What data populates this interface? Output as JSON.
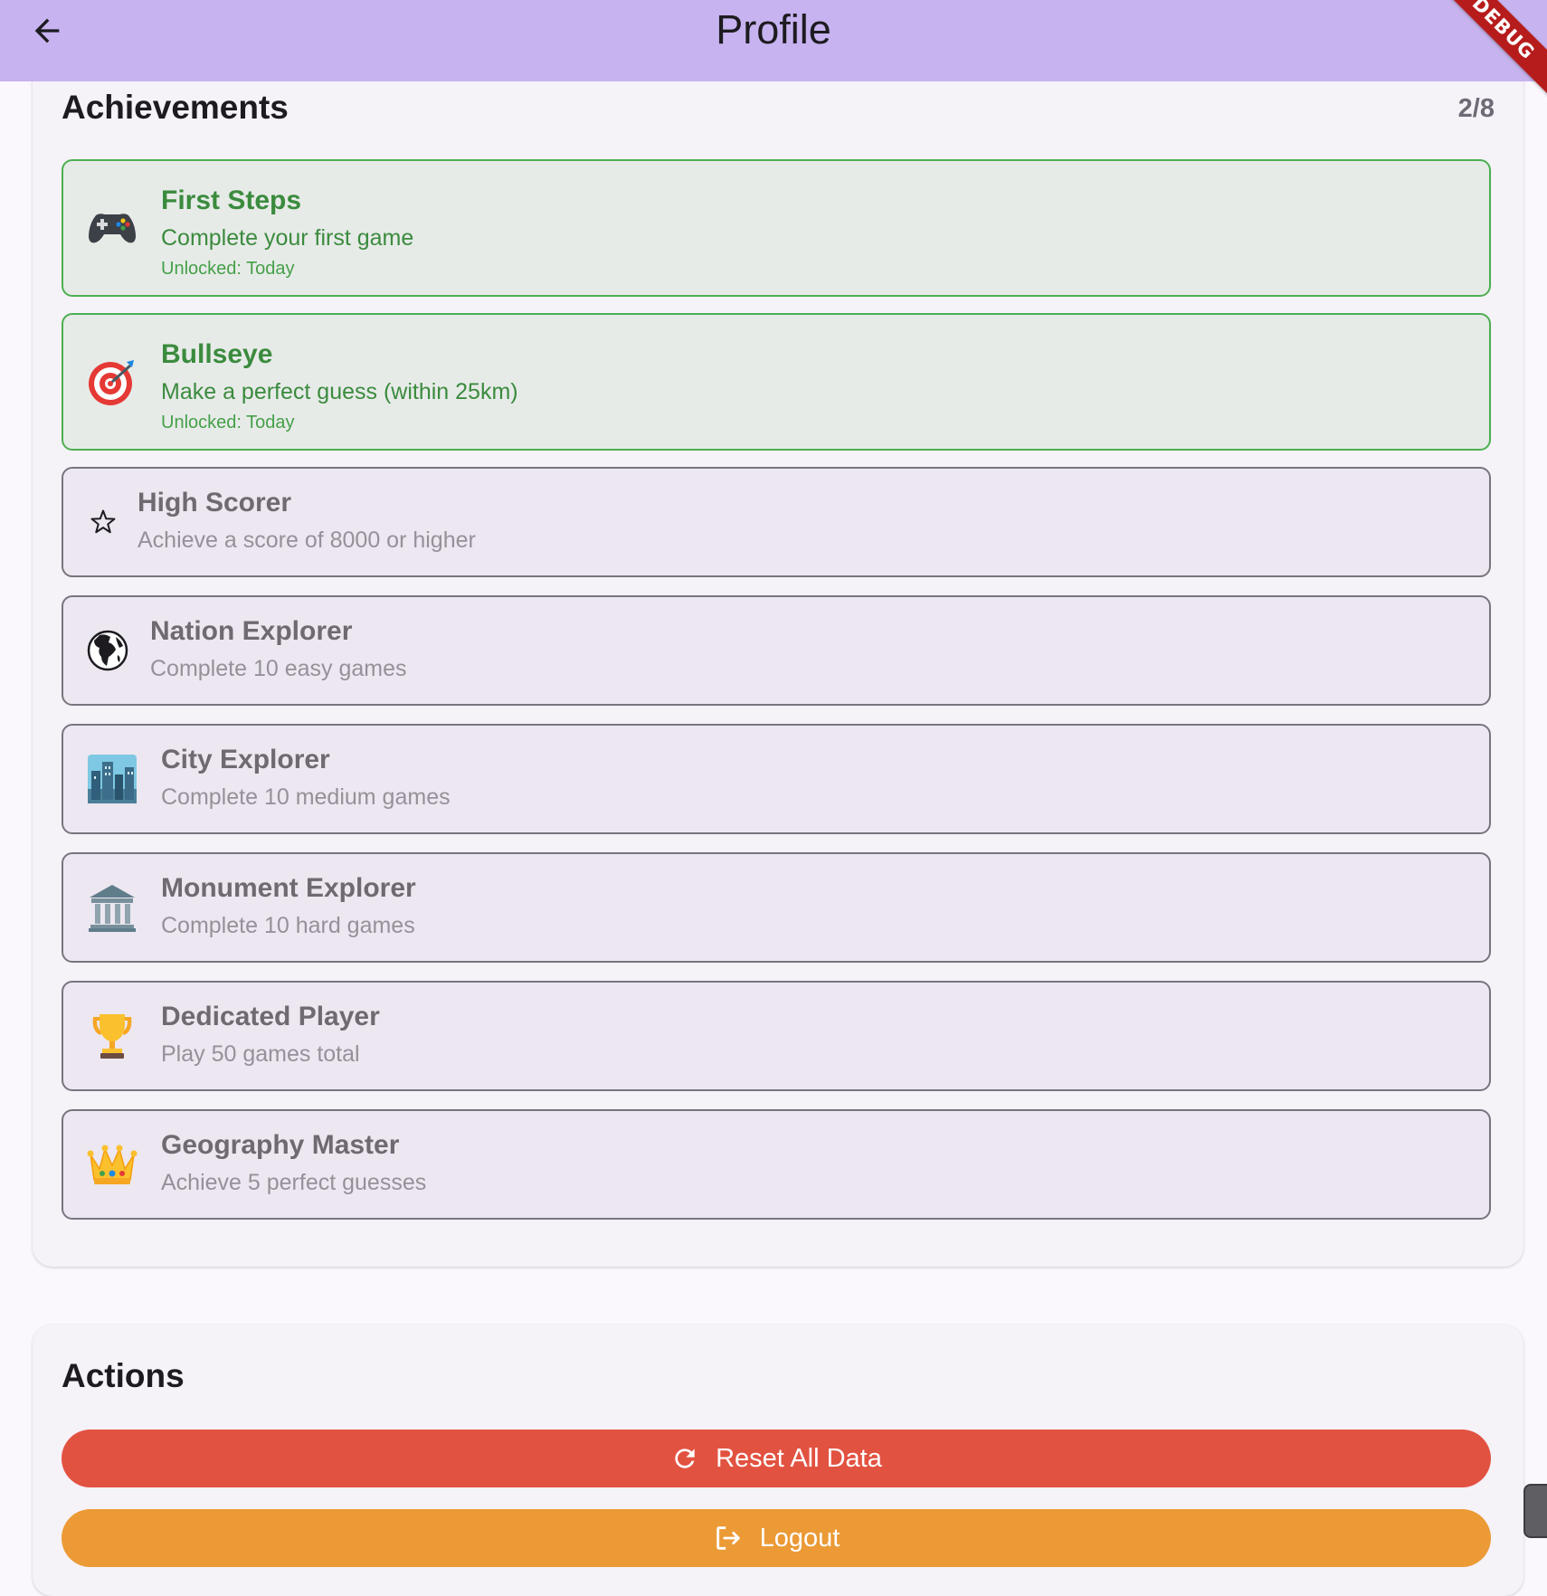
{
  "appbar": {
    "title": "Profile",
    "back_icon": "arrow-back-icon"
  },
  "debug_banner": "DEBUG",
  "achievements": {
    "title": "Achievements",
    "count": "2/8",
    "items": [
      {
        "name": "First Steps",
        "description": "Complete your first game",
        "unlocked": "Unlocked: Today",
        "icon": "game-controller-icon"
      },
      {
        "name": "Bullseye",
        "description": "Make a perfect guess (within 25km)",
        "unlocked": "Unlocked: Today",
        "icon": "target-icon"
      },
      {
        "name": "High Scorer",
        "description": "Achieve a score of 8000 or higher",
        "icon": "star-icon"
      },
      {
        "name": "Nation Explorer",
        "description": "Complete 10 easy games",
        "icon": "globe-icon"
      },
      {
        "name": "City Explorer",
        "description": "Complete 10 medium games",
        "icon": "city-icon"
      },
      {
        "name": "Monument Explorer",
        "description": "Complete 10 hard games",
        "icon": "monument-icon"
      },
      {
        "name": "Dedicated Player",
        "description": "Play 50 games total",
        "icon": "trophy-icon"
      },
      {
        "name": "Geography Master",
        "description": "Achieve 5 perfect guesses",
        "icon": "crown-icon"
      }
    ]
  },
  "actions": {
    "title": "Actions",
    "reset_label": "Reset All Data",
    "logout_label": "Logout"
  },
  "colors": {
    "appbar": "#c6b3ef",
    "unlocked_border": "#4caf50",
    "unlocked_text": "#3b8b3e",
    "reset_button": "#e25241",
    "logout_button": "#eb9a36"
  }
}
